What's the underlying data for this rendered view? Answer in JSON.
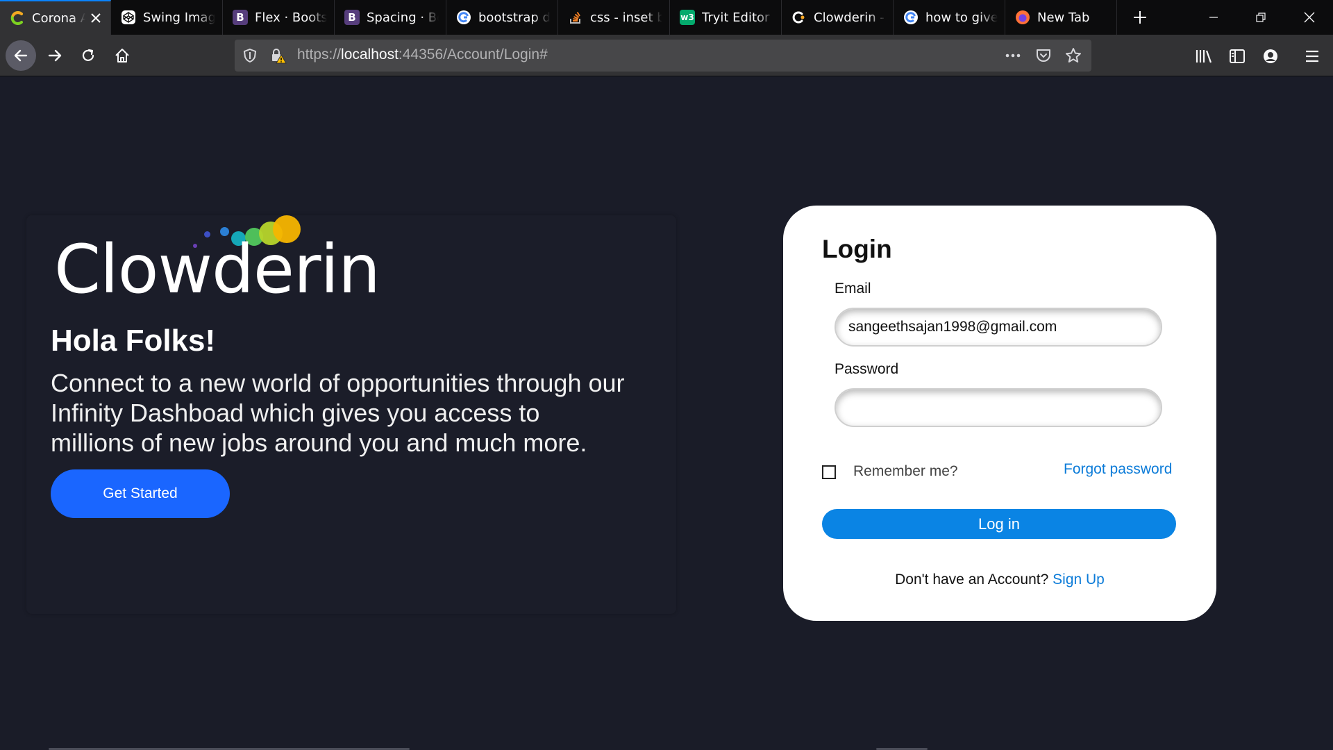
{
  "browser": {
    "tabs": [
      {
        "title": "Corona Admin",
        "icon": "clowderin-c-icon",
        "active": true
      },
      {
        "title": "Swing Image",
        "icon": "codepen-icon"
      },
      {
        "title": "Flex · Bootstrap",
        "icon": "bootstrap-icon"
      },
      {
        "title": "Spacing · Bootstrap",
        "icon": "bootstrap-icon"
      },
      {
        "title": "bootstrap d",
        "icon": "google-icon"
      },
      {
        "title": "css - inset bo",
        "icon": "stackoverflow-icon"
      },
      {
        "title": "Tryit Editor v",
        "icon": "w3schools-icon"
      },
      {
        "title": "Clowderin -",
        "icon": "clowderin-icon"
      },
      {
        "title": "how to give",
        "icon": "google-icon"
      },
      {
        "title": "New Tab",
        "icon": "firefox-icon"
      }
    ],
    "url": {
      "scheme": "https://",
      "host": "localhost",
      "rest": ":44356/Account/Login#"
    },
    "accent": "#0a84ff"
  },
  "hero": {
    "logo_text": "Clowderin",
    "title": "Hola Folks!",
    "body": "Connect to a new world of opportunities through our Infinity Dashboad which gives you access to millions of new jobs around you and much more.",
    "cta_label": "Get Started",
    "cta_color": "#1a66ff"
  },
  "login": {
    "title": "Login",
    "email_label": "Email",
    "email_value": "sangeethsajan1998@gmail.com",
    "password_label": "Password",
    "password_value": "",
    "remember_label": "Remember me?",
    "remember_checked": false,
    "forgot_label": "Forgot password",
    "submit_label": "Log in",
    "signup_prompt": "Don't have an Account?",
    "signup_link": "Sign Up",
    "link_color": "#0b7bd8",
    "button_color": "#0a84e4"
  },
  "page_background": "#1a1c28"
}
